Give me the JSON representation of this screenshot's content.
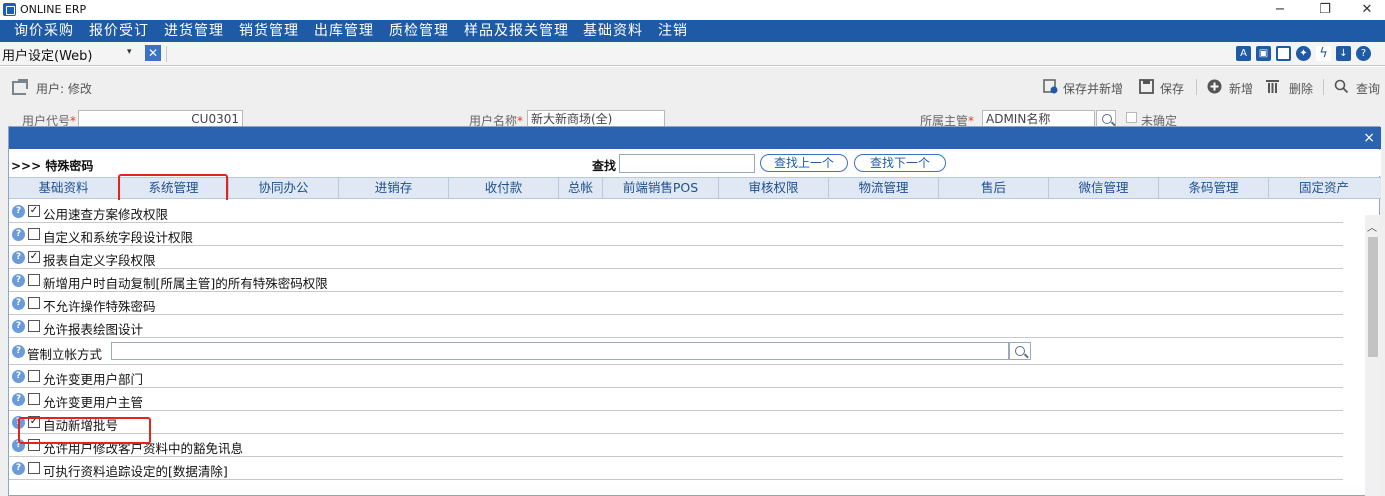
{
  "window": {
    "title": "ONLINE ERP",
    "minimize": "−",
    "maximize": "❐",
    "close": "✕"
  },
  "menu": [
    "询价采购",
    "报价受订",
    "进货管理",
    "销货管理",
    "出库管理",
    "质检管理",
    "样品及报关管理",
    "基础资料",
    "注销"
  ],
  "toolbar": {
    "active_tab": "用户设定(Web)",
    "dropdown": "▾",
    "close": "✕"
  },
  "form": {
    "title": "用户: 修改",
    "actions": {
      "save_new": "保存并新增",
      "save": "保存",
      "add": "新增",
      "delete": "删除",
      "query": "查询"
    },
    "fields": {
      "user_code_label": "用户代号",
      "user_code_value": "CU0301",
      "user_name_label": "用户名称",
      "user_name_value": "新大新商场(全)",
      "supervisor_label": "所属主管",
      "supervisor_value": "ADMIN名称",
      "unconfirmed": "未确定"
    }
  },
  "modal": {
    "close": "×",
    "heading": ">>> 特殊密码",
    "find_label": "查找",
    "find_prev": "查找上一个",
    "find_next": "查找下一个",
    "tabs": [
      "基础资料",
      "系统管理",
      "协同办公",
      "进销存",
      "收付款",
      "总帐",
      "前端销售POS",
      "审核权限",
      "物流管理",
      "售后",
      "微信管理",
      "条码管理",
      "固定资产"
    ],
    "active_tab_index": 1,
    "rows": [
      {
        "label": "公用速查方案修改权限",
        "checked": true
      },
      {
        "label": "自定义和系统字段设计权限",
        "checked": false
      },
      {
        "label": "报表自定义字段权限",
        "checked": true
      },
      {
        "label": "新增用户时自动复制[所属主管]的所有特殊密码权限",
        "checked": false
      },
      {
        "label": "不允许操作特殊密码",
        "checked": false
      },
      {
        "label": "允许报表绘图设计",
        "checked": false
      },
      {
        "label": "管制立帐方式",
        "checked": null
      },
      {
        "label": "允许变更用户部门",
        "checked": false
      },
      {
        "label": "允许变更用户主管",
        "checked": false
      },
      {
        "label": "自动新增批号",
        "checked": true
      },
      {
        "label": "允许用户修改客户资料中的豁免讯息",
        "checked": false
      },
      {
        "label": "可执行资料追踪设定的[数据清除]",
        "checked": false
      }
    ]
  }
}
